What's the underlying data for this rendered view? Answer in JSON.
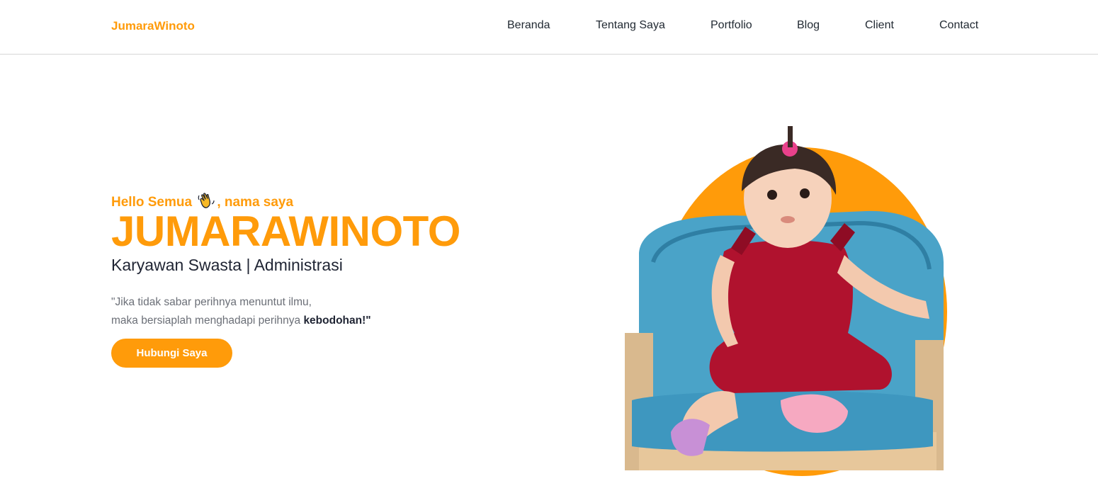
{
  "header": {
    "brand": "JumaraWinoto",
    "nav": [
      {
        "label": "Beranda"
      },
      {
        "label": "Tentang Saya"
      },
      {
        "label": "Portfolio"
      },
      {
        "label": "Blog"
      },
      {
        "label": "Client"
      },
      {
        "label": "Contact"
      }
    ]
  },
  "hero": {
    "greeting_before": "Hello Semua",
    "greeting_after": ", nama saya",
    "greeting_icon": "waving-hand-icon",
    "name": "JUMARAWINOTO",
    "role": "Karyawan Swasta | Administrasi",
    "quote_line1": "\"Jika tidak sabar perihnya menuntut ilmu,",
    "quote_line2": "maka bersiaplah menghadapi perihnya ",
    "quote_emphasis": "kebodohan!\"",
    "cta_label": "Hubungi Saya",
    "image_icon": "profile-photo-child-on-chair"
  },
  "colors": {
    "accent": "#ff9b0a",
    "text": "#1f2433",
    "muted": "#6b6f77",
    "chair": "#4aa3c8",
    "outfit": "#b0122e"
  }
}
